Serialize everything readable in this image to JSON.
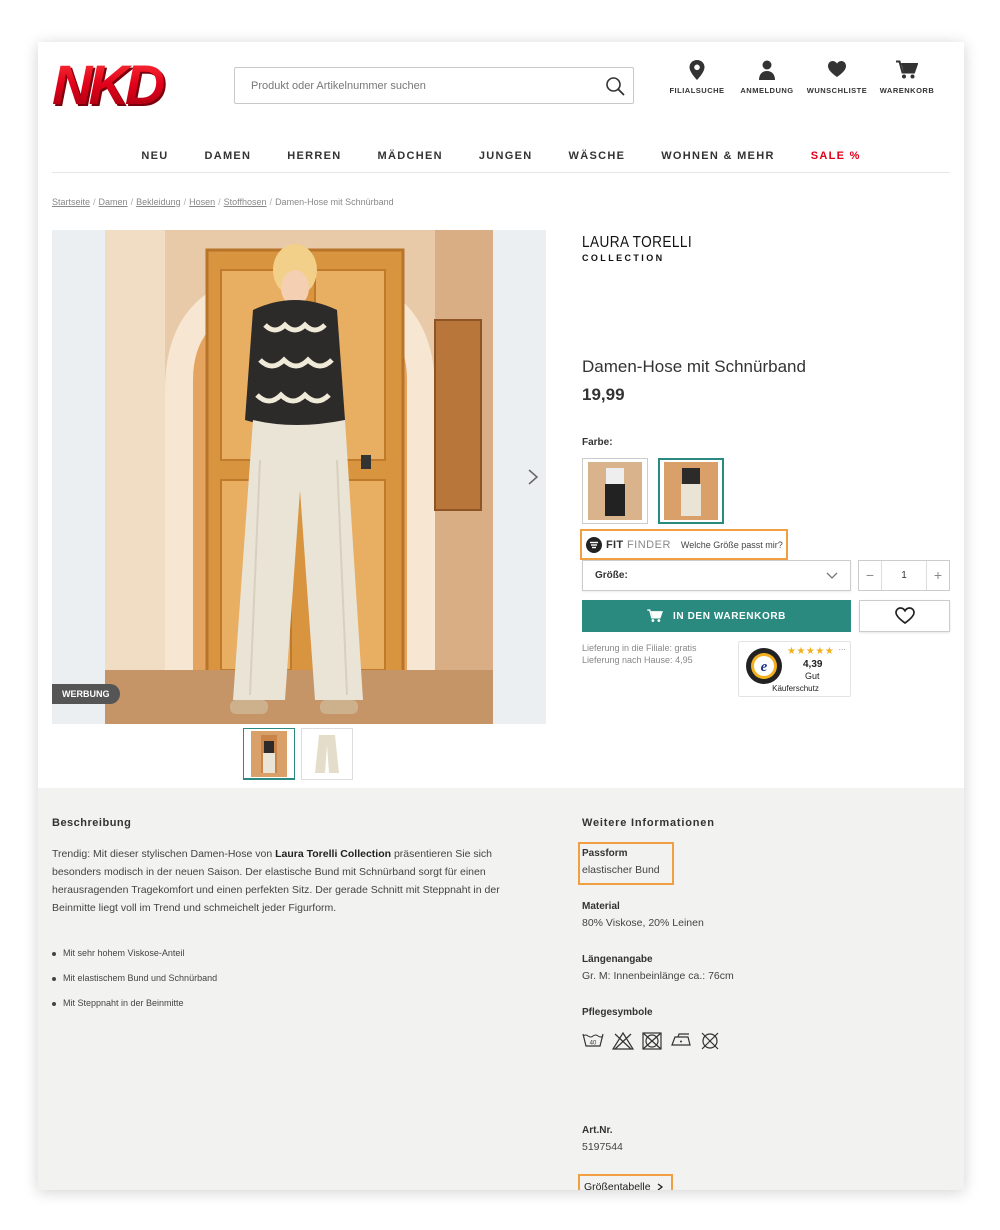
{
  "header": {
    "logo_text": "NKD",
    "search_placeholder": "Produkt oder Artikelnummer suchen",
    "icons": [
      {
        "icon": "location-pin-icon",
        "label": "FILIALSUCHE"
      },
      {
        "icon": "user-icon",
        "label": "ANMELDUNG"
      },
      {
        "icon": "heart-icon",
        "label": "WUNSCHLISTE"
      },
      {
        "icon": "cart-icon",
        "label": "WARENKORB"
      }
    ]
  },
  "nav": {
    "items": [
      "NEU",
      "DAMEN",
      "HERREN",
      "MÄDCHEN",
      "JUNGEN",
      "WÄSCHE",
      "WOHNEN & MEHR",
      "SALE %"
    ]
  },
  "breadcrumb": {
    "links": [
      "Startseite",
      "Damen",
      "Bekleidung",
      "Hosen",
      "Stoffhosen"
    ],
    "current": "Damen-Hose mit Schnürband"
  },
  "gallery": {
    "badge": "WERBUNG"
  },
  "product": {
    "brand_line1": "LAURA TORELLI",
    "brand_line2": "COLLECTION",
    "title": "Damen-Hose mit Schnürband",
    "price": "19,99",
    "color_label": "Farbe:",
    "fitfinder_brand_bold": "FIT",
    "fitfinder_brand_light": " FINDER",
    "fitfinder_question": "Welche Größe passt mir?",
    "size_label": "Größe:",
    "quantity": "1",
    "qty_minus": "−",
    "qty_plus": "+",
    "cart_button": "IN DEN WARENKORB",
    "delivery_store": "Lieferung in die Filiale: gratis",
    "delivery_home": "Lieferung nach Hause: 4,95"
  },
  "trusted": {
    "stars": "★★★★★",
    "rating": "4,39",
    "grade": "Gut",
    "label": "Käuferschutz",
    "more": "..."
  },
  "description": {
    "heading": "Beschreibung",
    "text_before": "Trendig: Mit dieser stylischen Damen-Hose von ",
    "text_bold": "Laura Torelli Collection",
    "text_after": " präsentieren Sie sich besonders modisch in der neuen Saison. Der elastische Bund mit Schnürband sorgt für einen herausragenden Tragekomfort und einen perfekten Sitz. Der gerade Schnitt mit Steppnaht in der Beinmitte liegt voll im Trend und schmeichelt jeder Figurform.",
    "bullets": [
      "Mit sehr hohem Viskose-Anteil",
      "Mit elastischem Bund und Schnürband",
      "Mit Steppnaht in der Beinmitte"
    ]
  },
  "more_info": {
    "heading": "Weitere Informationen",
    "fit_label": "Passform",
    "fit_value": "elastischer Bund",
    "material_label": "Material",
    "material_value": "80% Viskose, 20% Leinen",
    "length_label": "Längenangabe",
    "length_value": "Gr. M: Innenbeinlänge ca.: 76cm",
    "care_label": "Pflegesymbole",
    "care_icons": [
      "wash-40-icon",
      "no-bleach-icon",
      "no-tumble-dry-icon",
      "iron-low-icon",
      "no-dry-clean-icon"
    ],
    "care_wash_temp": "40",
    "art_label": "Art.Nr.",
    "art_value": "5197544",
    "size_table_link": "Größentabelle"
  },
  "colors": {
    "accent": "#2b8a80",
    "brand_red": "#e2001a",
    "highlight": "#f0a043",
    "info_bg": "#f2f2f1"
  }
}
